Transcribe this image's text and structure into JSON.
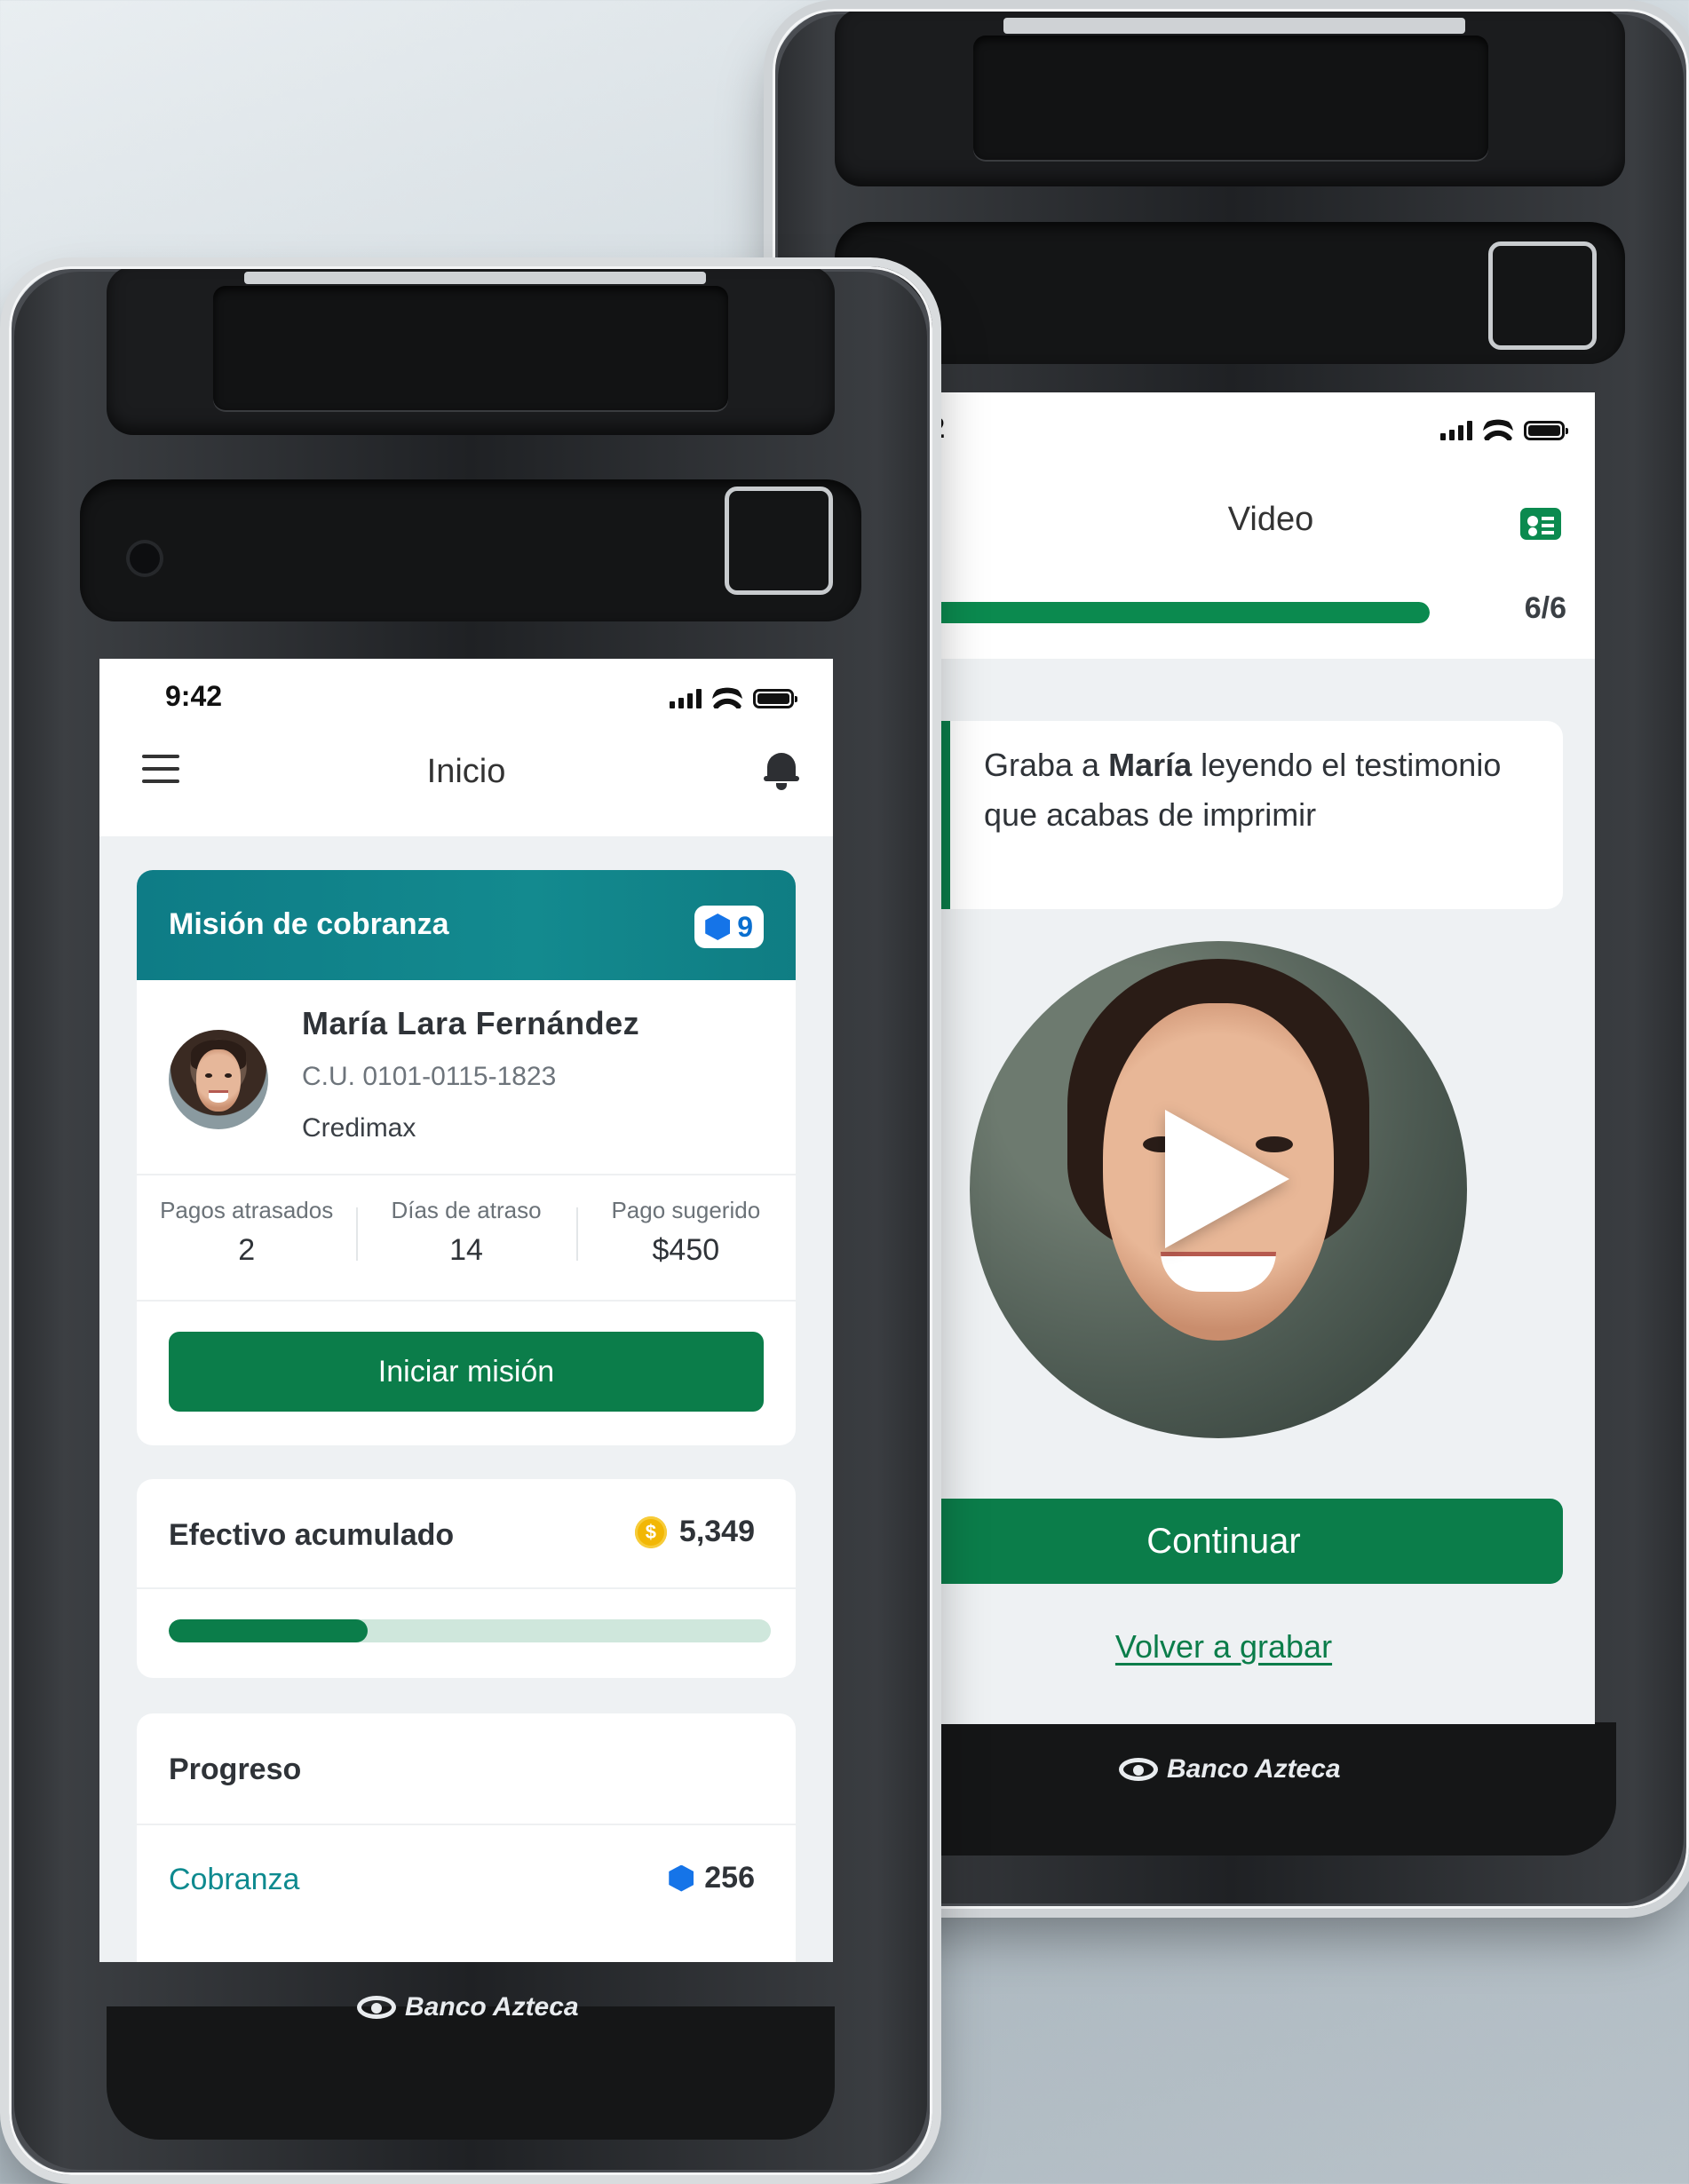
{
  "left_device": {
    "brand": "Banco Azteca",
    "status": {
      "time": "9:42"
    },
    "appbar": {
      "title": "Inicio"
    },
    "mission": {
      "title": "Misión de cobranza",
      "badge_count": "9",
      "customer_name": "María Lara Fernández",
      "customer_id": "C.U. 0101-0115-1823",
      "product": "Credimax",
      "stats": [
        {
          "label": "Pagos atrasados",
          "value": "2"
        },
        {
          "label": "Días de atraso",
          "value": "14"
        },
        {
          "label": "Pago sugerido",
          "value": "$450"
        }
      ],
      "start_button": "Iniciar misión"
    },
    "cash": {
      "label": "Efectivo acumulado",
      "coin_symbol": "$",
      "amount": "5,349",
      "progress_fraction": 0.33
    },
    "progress": {
      "title": "Progreso",
      "item_label": "Cobranza",
      "item_count": "256"
    }
  },
  "right_device": {
    "brand": "Banco Azteca",
    "status": {
      "time": "9:42"
    },
    "appbar": {
      "title": "Video"
    },
    "step_label": "6/6",
    "step_fraction": 1.0,
    "instruction": {
      "part1": "Graba a ",
      "bold": "María",
      "part2": " leyendo el testimonio que acabas de imprimir"
    },
    "continue_button": "Continuar",
    "rerecord_link": "Volver a grabar"
  },
  "colors": {
    "accent_green": "#0b7d4a",
    "teal_header": "#0e7c86",
    "gem_blue": "#1574e8",
    "coin_yellow": "#f2b705"
  },
  "icons": [
    "menu-icon",
    "bell-icon",
    "gem-icon",
    "coin-icon",
    "id-card-icon",
    "play-icon",
    "signal-icon",
    "wifi-icon",
    "battery-icon",
    "bank-logo-icon"
  ]
}
